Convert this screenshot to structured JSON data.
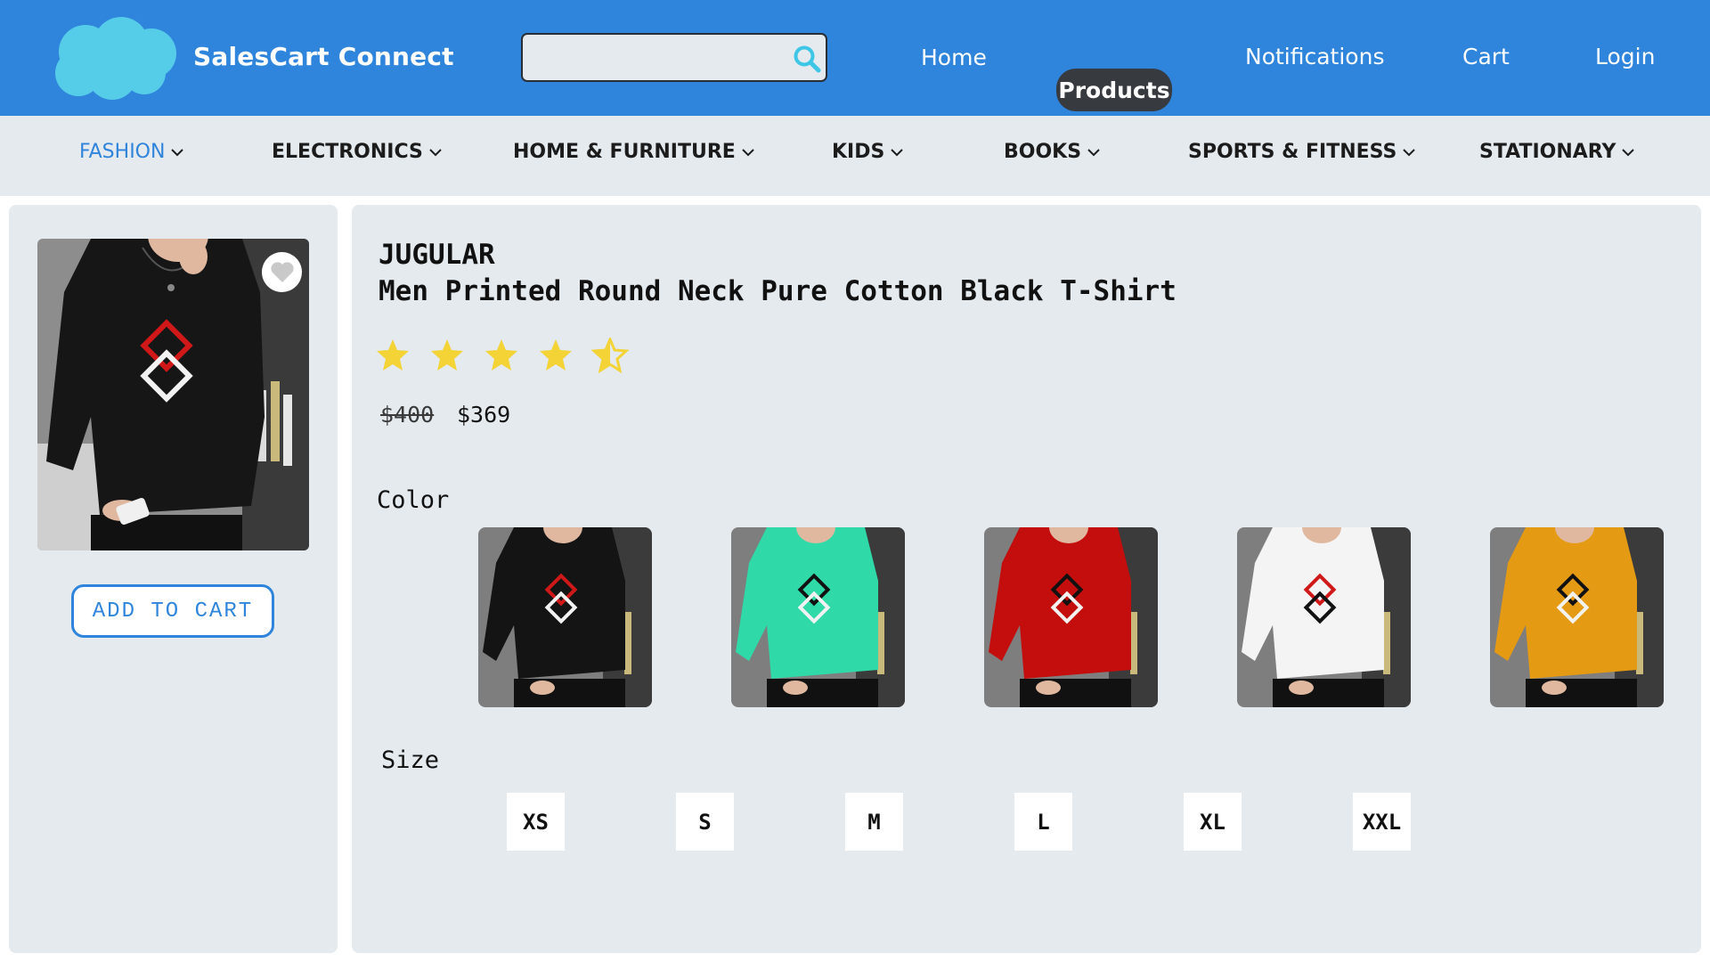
{
  "header": {
    "brand": "SalesCart Connect",
    "search": {
      "value": "",
      "placeholder": ""
    },
    "nav": [
      "Home",
      "Products",
      "Notifications",
      "Cart",
      "Login"
    ],
    "active_nav": "Products",
    "colors": {
      "bar": "#2f84dc",
      "active_pill": "#373a3f",
      "logo": "#56cde8"
    }
  },
  "categories": [
    {
      "label": "FASHION",
      "active": true
    },
    {
      "label": "ELECTRONICS",
      "active": false
    },
    {
      "label": "HOME & FURNITURE",
      "active": false
    },
    {
      "label": "KIDS",
      "active": false
    },
    {
      "label": "BOOKS",
      "active": false
    },
    {
      "label": "SPORTS & FITNESS",
      "active": false
    },
    {
      "label": "STATIONARY",
      "active": false
    }
  ],
  "product": {
    "brand": "JUGULAR",
    "title": "Men Printed Round Neck Pure Cotton Black T-Shirt",
    "rating": 4.5,
    "rating_max": 5,
    "old_price": "$400",
    "price": "$369",
    "add_to_cart": "ADD TO CART",
    "color_label": "Color",
    "size_label": "Size",
    "colors": [
      {
        "name": "black",
        "hex": "#141414"
      },
      {
        "name": "teal",
        "hex": "#2fd9a8"
      },
      {
        "name": "red",
        "hex": "#c40d0d"
      },
      {
        "name": "white",
        "hex": "#f4f4f4"
      },
      {
        "name": "orange",
        "hex": "#e59a14"
      }
    ],
    "sizes": [
      "XS",
      "S",
      "M",
      "L",
      "XL",
      "XXL"
    ]
  }
}
